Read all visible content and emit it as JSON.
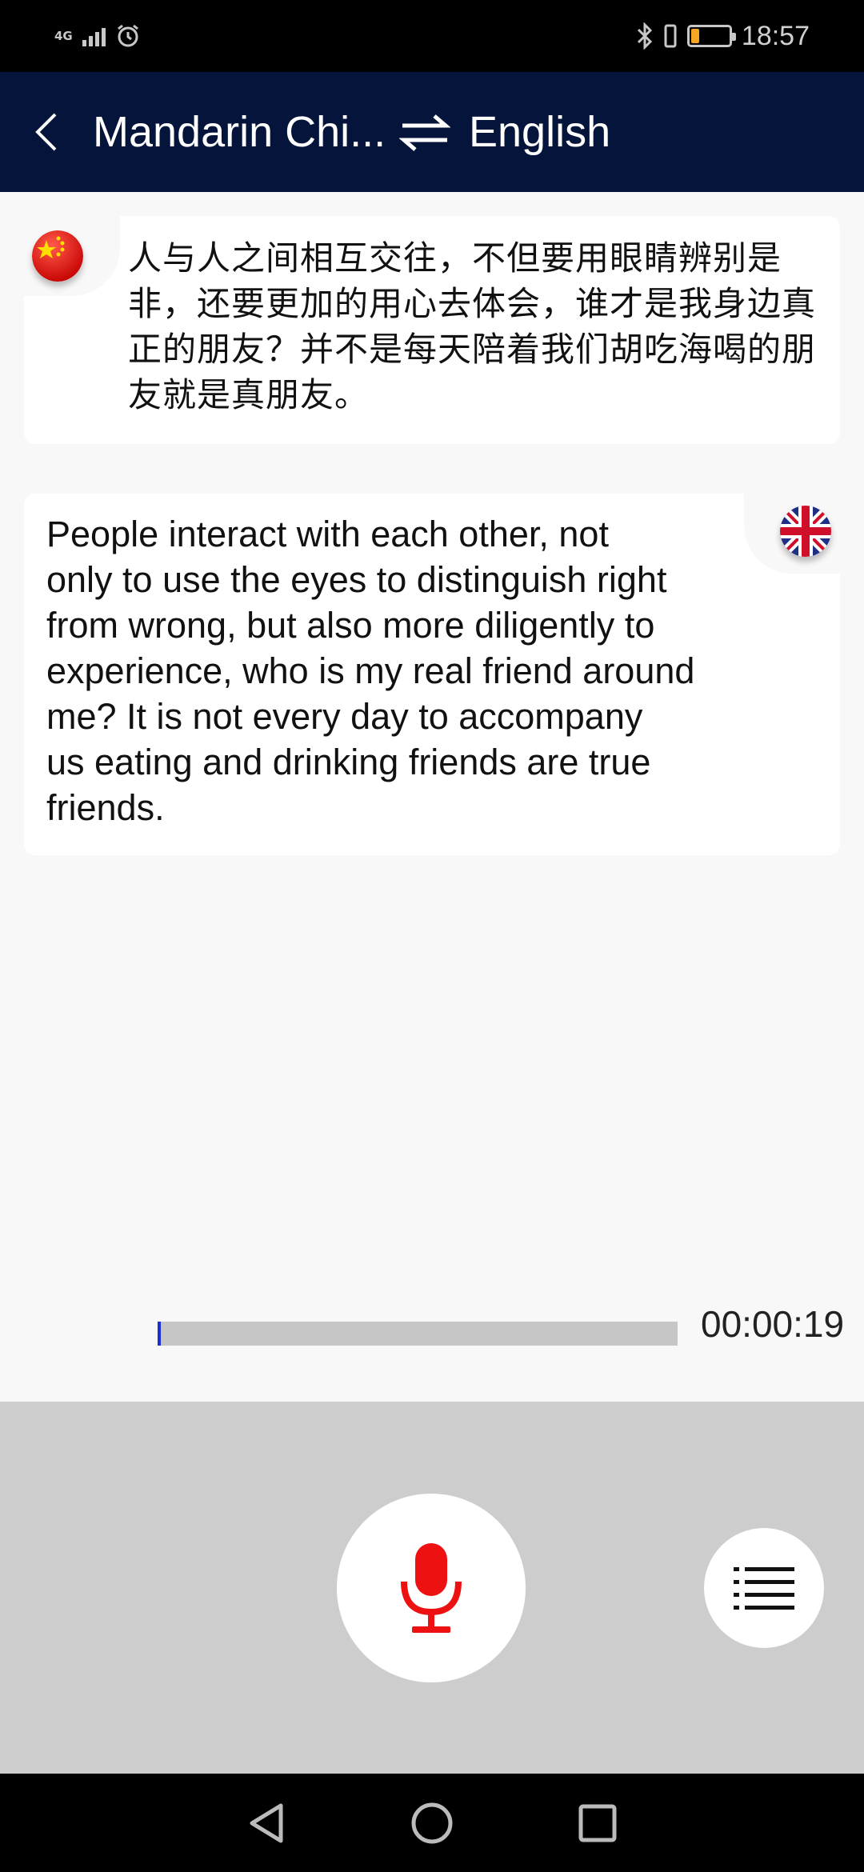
{
  "status_bar": {
    "network": "4G",
    "time": "18:57",
    "battery_level": 0.22,
    "battery_color": "#f5a623"
  },
  "app_bar": {
    "source_language": "Mandarin Chi...",
    "target_language": "English",
    "background": "#04143a"
  },
  "conversation": [
    {
      "language": "zh",
      "flag": "china-flag",
      "text": "人与人之间相互交往，不但要用眼睛辨别是非，还要更加的用心去体会，谁才是我身边真正的朋友？并不是每天陪着我们胡吃海喝的朋友就是真朋友。"
    },
    {
      "language": "en",
      "flag": "uk-flag",
      "text": "People interact with each other, not\nonly to use the eyes to distinguish right\nfrom wrong, but also more diligently to\nexperience, who is my real friend around\nme? It is not every day to accompany\nus eating and drinking friends are true\nfriends."
    }
  ],
  "playback": {
    "elapsed": "00:00:19",
    "progress": 0.005
  },
  "controls": {
    "mic_icon": "microphone-icon",
    "menu_icon": "list-menu-icon",
    "accent": "#ee1111"
  },
  "nav": {
    "back_icon": "nav-back-icon",
    "home_icon": "nav-home-icon",
    "recents_icon": "nav-recents-icon"
  }
}
